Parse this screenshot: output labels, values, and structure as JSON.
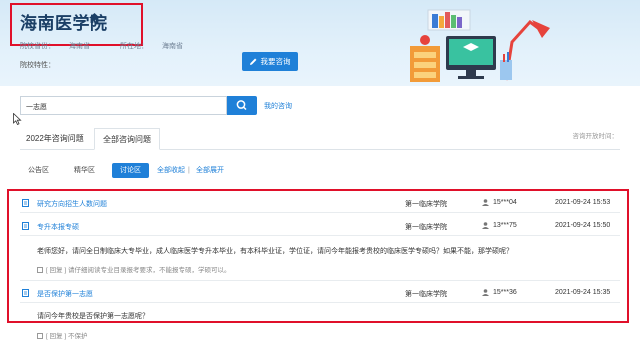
{
  "header": {
    "school_name": "海南医学院",
    "region_label": "院校省份：",
    "region_value": "海南省",
    "location_label": "所在地：",
    "location_value": "海南省",
    "feature_label": "院校特性：",
    "ask_button": "我要咨询"
  },
  "search": {
    "value": "一志愿",
    "my_ask": "我的咨询"
  },
  "tabs": [
    {
      "label": "2022年咨询问题"
    },
    {
      "label": "全部咨询问题"
    }
  ],
  "open_time_label": "咨询开放时间：",
  "subtabs": [
    {
      "label": "公告区"
    },
    {
      "label": "精华区"
    },
    {
      "label": "讨论区"
    },
    {
      "label": "全部收起"
    },
    {
      "label": "|"
    },
    {
      "label": "全部展开"
    }
  ],
  "questions": [
    {
      "title": "研究方向招生人数问题",
      "dept": "第一临床学院",
      "user": "15***04",
      "date": "2021-09-24 15:53"
    },
    {
      "title": "专升本报专硕",
      "dept": "第一临床学院",
      "user": "13***75",
      "date": "2021-09-24 15:50",
      "body": "老师您好，请问全日制临床大专毕业，成人临床医学专升本毕业，有本科毕业证，学位证，请问今年能报考贵校的临床医学专硕吗？如果不能，那学硕呢？",
      "reply": "[ 回复 ] 请仔细阅读专业目录报考要求，不能报专硕，学硕可以。"
    },
    {
      "title": "是否保护第一志愿",
      "dept": "第一临床学院",
      "user": "15***36",
      "date": "2021-09-24 15:35",
      "body": "请问今年贵校是否保护第一志愿呢？",
      "reply": "[ 回复 ] 不保护"
    }
  ],
  "colors": {
    "accent": "#1f80d8",
    "highlight_box": "#e0102a",
    "banner_bg": "#d5e9f7"
  },
  "icons": [
    "home-icon",
    "pencil-icon",
    "search-icon",
    "document-icon",
    "user-icon",
    "mouse-cursor-icon"
  ]
}
